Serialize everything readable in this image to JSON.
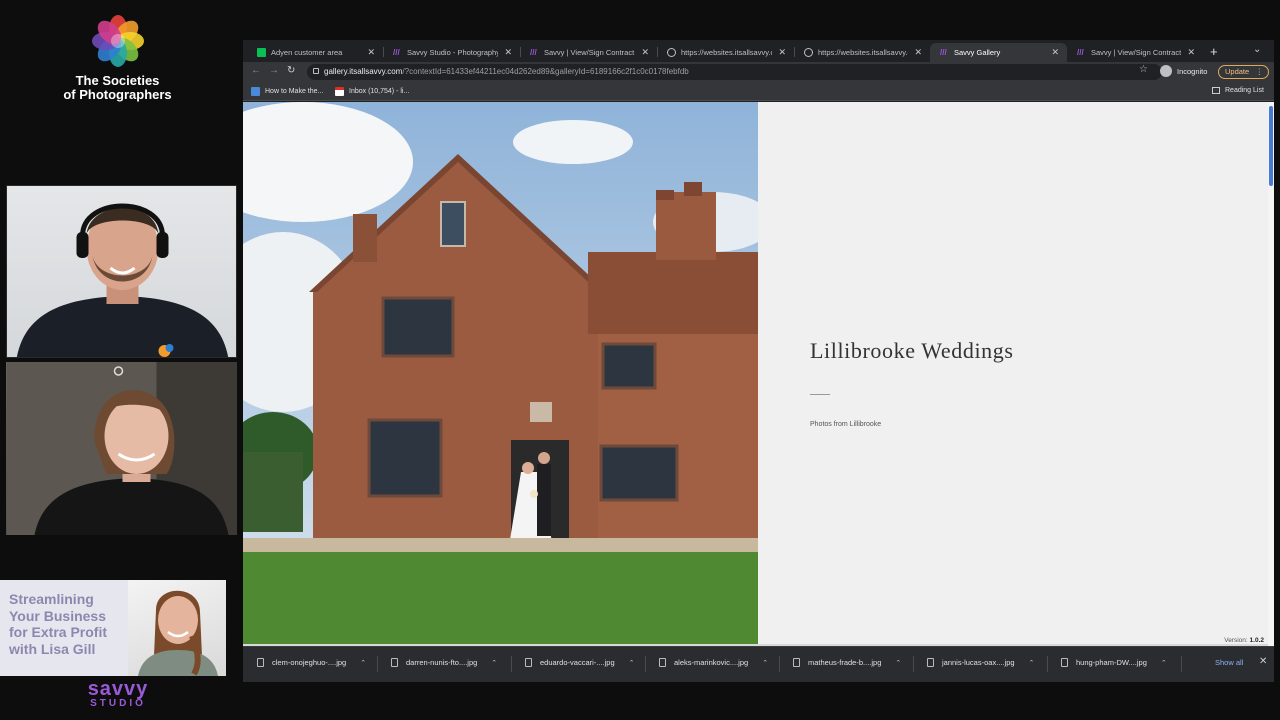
{
  "society": {
    "name_line1": "The Societies",
    "name_line2": "of Photographers"
  },
  "promo": {
    "line1": "Streamlining",
    "line2": "Your Business",
    "line3": "for Extra Profit",
    "line4": "with Lisa Gill"
  },
  "savvy_logo": {
    "word1": "savvy",
    "word2": "STUDIO"
  },
  "browser": {
    "tabs": [
      {
        "label": "Adyen customer area",
        "icon": "adyen-icon",
        "color": "#0abf53"
      },
      {
        "label": "Savvy Studio - Photography S",
        "icon": "savvy-icon",
        "color": "#8a49c9"
      },
      {
        "label": "Savvy | View/Sign Contract",
        "icon": "savvy-icon",
        "color": "#8a49c9"
      },
      {
        "label": "https://websites.itsallsavvy.co",
        "icon": "globe-icon",
        "color": "#bdc1c6"
      },
      {
        "label": "https://websites.itsallsavvy.co",
        "icon": "globe-icon",
        "color": "#bdc1c6"
      },
      {
        "label": "Savvy Gallery",
        "icon": "savvy-icon",
        "color": "#8a49c9",
        "active": true
      },
      {
        "label": "Savvy | View/Sign Contract",
        "icon": "savvy-icon",
        "color": "#8a49c9"
      }
    ],
    "url_host": "gallery.itsallsavvy.com",
    "url_path": "/?contextId=61433ef44211ec04d262ed89&galleryId=6189166c2f1c0c0178febfdb",
    "incognito_label": "Incognito",
    "update_label": "Update",
    "bookmarks": [
      {
        "label": "How to Make the...",
        "icon": "bookmark-page-icon"
      },
      {
        "label": "Inbox (10,754) - li...",
        "icon": "gmail-icon"
      }
    ],
    "reading_list_label": "Reading List"
  },
  "gallery": {
    "title": "Lillibrooke Weddings",
    "subtitle": "Photos from Lillibrooke",
    "version_prefix": "Version:",
    "version": "1.0.2"
  },
  "downloads": {
    "files": [
      "clem-onojeghuo-....jpg",
      "darren-nunis-fto....jpg",
      "eduardo-vaccari-....jpg",
      "aleks-marinkovic....jpg",
      "matheus-frade-b....jpg",
      "jannis-lucas-oax....jpg",
      "hung-pham-DW....jpg"
    ],
    "show_all_label": "Show all"
  }
}
